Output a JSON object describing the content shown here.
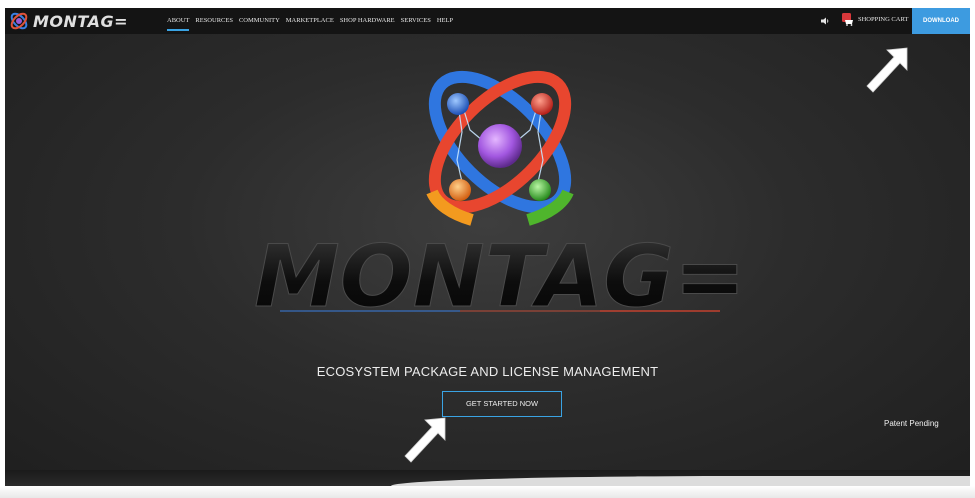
{
  "brand": {
    "name": "MONTAG=",
    "icon": "montag-logo-icon"
  },
  "nav": {
    "items": [
      {
        "label": "ABOUT",
        "active": true
      },
      {
        "label": "RESOURCES",
        "active": false
      },
      {
        "label": "COMMUNITY",
        "active": false
      },
      {
        "label": "MARKETPLACE",
        "active": false
      },
      {
        "label": "SHOP HARDWARE",
        "active": false
      },
      {
        "label": "SERVICES",
        "active": false
      },
      {
        "label": "HELP",
        "active": false
      }
    ],
    "speaker_icon": "speaker-icon",
    "cart_label": "SHOPPING CART",
    "download_label": "DOWNLOAD"
  },
  "hero": {
    "wordmark": "MONTAG=",
    "tagline": "ECOSYSTEM PACKAGE AND LICENSE MANAGEMENT",
    "cta_label": "GET STARTED NOW",
    "patent": "Patent Pending"
  },
  "colors": {
    "accent": "#3d9be0",
    "background": "#2c2c2c",
    "nav": "#141414"
  }
}
